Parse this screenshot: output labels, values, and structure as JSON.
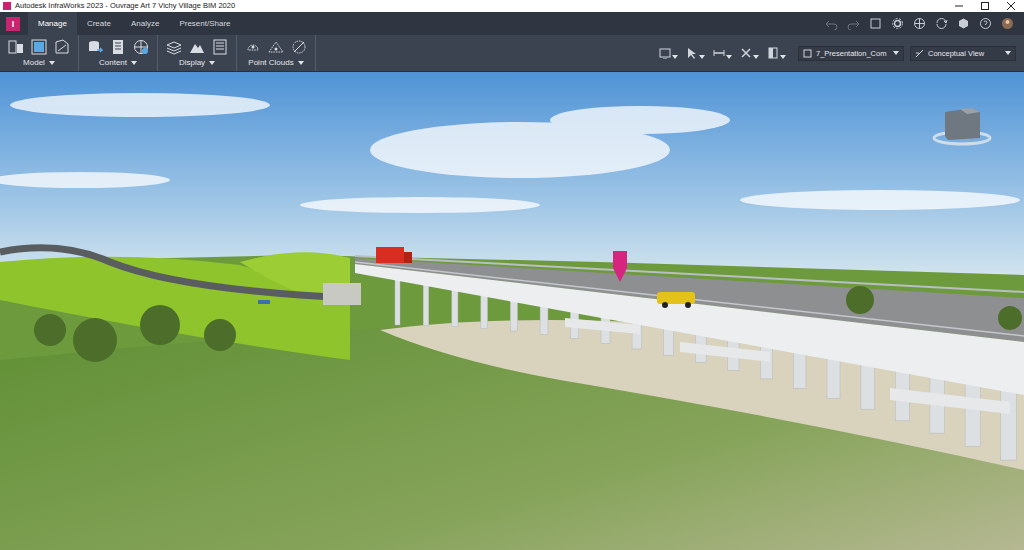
{
  "window": {
    "title": "Autodesk InfraWorks 2023 - Ouvrage Art 7 Vichy Village BIM 2020"
  },
  "app_logo": "I",
  "tabs": [
    {
      "label": "Manage",
      "selected": true
    },
    {
      "label": "Create",
      "selected": false
    },
    {
      "label": "Analyze",
      "selected": false
    },
    {
      "label": "Present/Share",
      "selected": false
    }
  ],
  "ribbon_groups": [
    {
      "label": "Model"
    },
    {
      "label": "Content"
    },
    {
      "label": "Display"
    },
    {
      "label": "Point Clouds"
    }
  ],
  "dropdowns": [
    {
      "value": "7_Presentation_Com"
    },
    {
      "value": "Conceptual View"
    }
  ]
}
